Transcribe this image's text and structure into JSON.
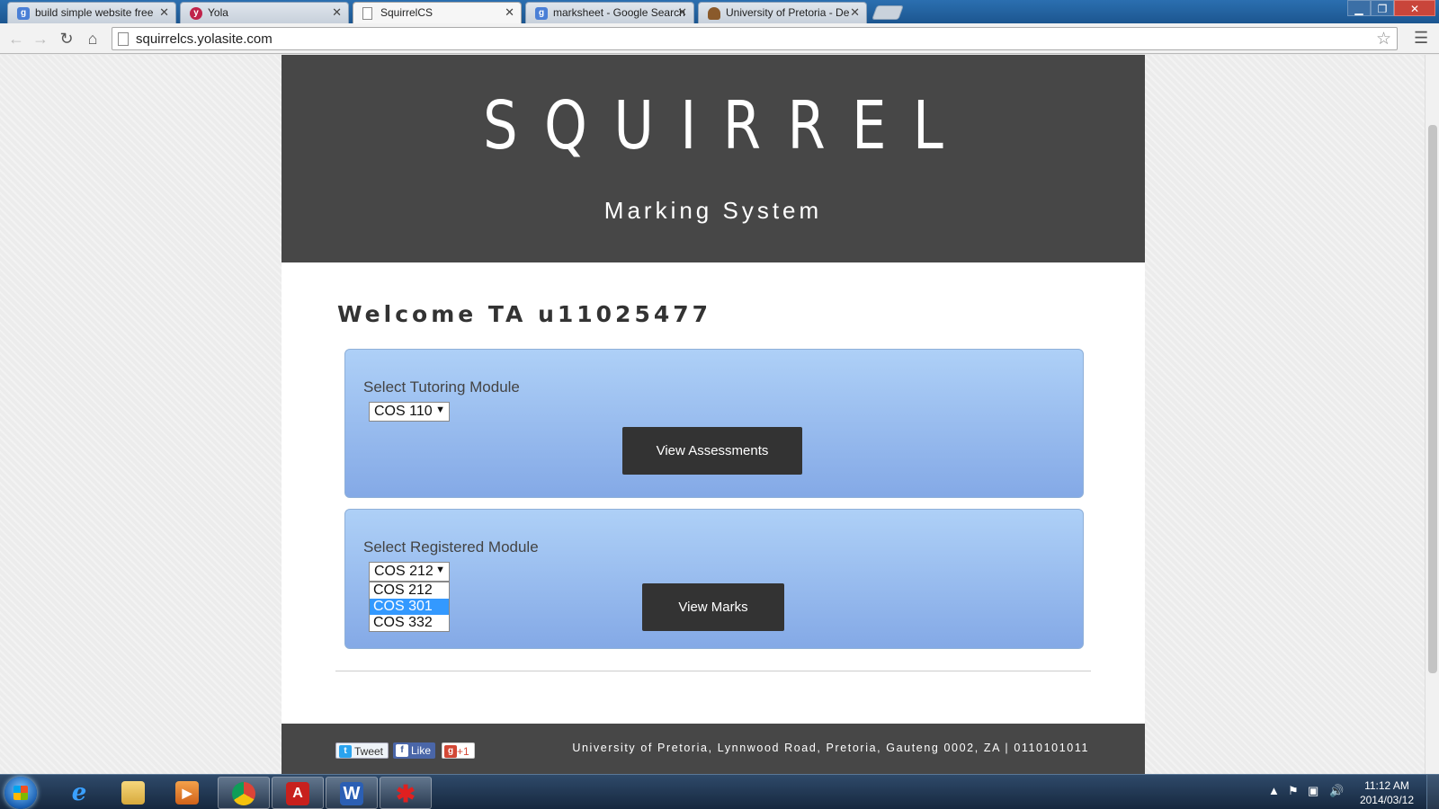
{
  "browser": {
    "tabs": [
      {
        "label": "build simple website free",
        "favicon": "google-icon",
        "active": false
      },
      {
        "label": "Yola",
        "favicon": "yola-icon",
        "active": false
      },
      {
        "label": "SquirrelCS",
        "favicon": "page-icon",
        "active": true
      },
      {
        "label": "marksheet - Google Search",
        "favicon": "google-icon",
        "active": false
      },
      {
        "label": "University of Pretoria - De",
        "favicon": "crest-icon",
        "active": false
      }
    ],
    "url": "squirrelcs.yolasite.com"
  },
  "site": {
    "logo": "SQUIRREL",
    "tagline": "Marking System",
    "welcome": "Welcome TA u11025477",
    "tutoring_panel": {
      "label": "Select Tutoring Module",
      "selected": "COS 110",
      "button": "View Assessments"
    },
    "registered_panel": {
      "label": "Select Registered Module",
      "selected": "COS 212",
      "options": [
        "COS 212",
        "COS 301",
        "COS 332"
      ],
      "highlighted_option": "COS 301",
      "button": "View Marks"
    },
    "footer": {
      "tweet": "Tweet",
      "like": "Like",
      "gplus": "+1",
      "address": "University of Pretoria, Lynnwood Road, Pretoria, Gauteng 0002, ZA | 0110101011"
    }
  },
  "taskbar": {
    "apps": [
      "internet-explorer-icon",
      "file-explorer-icon",
      "media-player-icon",
      "chrome-icon",
      "acrobat-icon",
      "word-icon",
      "paint-icon"
    ],
    "time": "11:12 AM",
    "date": "2014/03/12"
  },
  "colors": {
    "header_bg": "#474747",
    "panel_top": "#aed0f7",
    "panel_bottom": "#84a9e6",
    "button_bg": "#333333",
    "highlight": "#3399ff"
  }
}
